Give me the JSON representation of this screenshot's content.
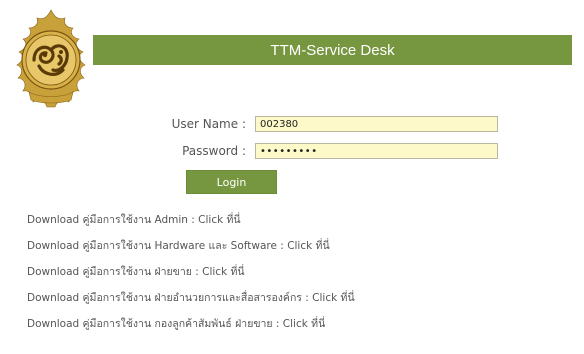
{
  "header": {
    "title": "TTM-Service Desk"
  },
  "logo": {
    "icon": "thai-emblem-seal-icon",
    "colors": [
      "#c79a26",
      "#8a5a10",
      "#f0d27a"
    ]
  },
  "form": {
    "username_label": "User Name :",
    "username_value": "002380",
    "password_label": "Password :",
    "password_value": "000000000",
    "login_label": "Login"
  },
  "downloads": [
    {
      "text": "Download คู่มือการใช้งาน Admin :",
      "link": "Click ที่นี่"
    },
    {
      "text": "Download คู่มือการใช้งาน Hardware และ Software :",
      "link": "Click ที่นี่"
    },
    {
      "text": "Download คู่มือการใช้งาน ฝ่ายขาย :",
      "link": "Click ที่นี่"
    },
    {
      "text": "Download คู่มือการใช้งาน ฝ่ายอำนวยการและสื่อสารองค์กร :",
      "link": "Click ที่นี่"
    },
    {
      "text": "Download คู่มือการใช้งาน กองลูกค้าสัมพันธ์ ฝ่ายขาย :",
      "link": "Click ที่นี่"
    }
  ],
  "colors": {
    "header_green": "#76973f",
    "input_bg": "#fdf9c8",
    "text": "#555555"
  }
}
